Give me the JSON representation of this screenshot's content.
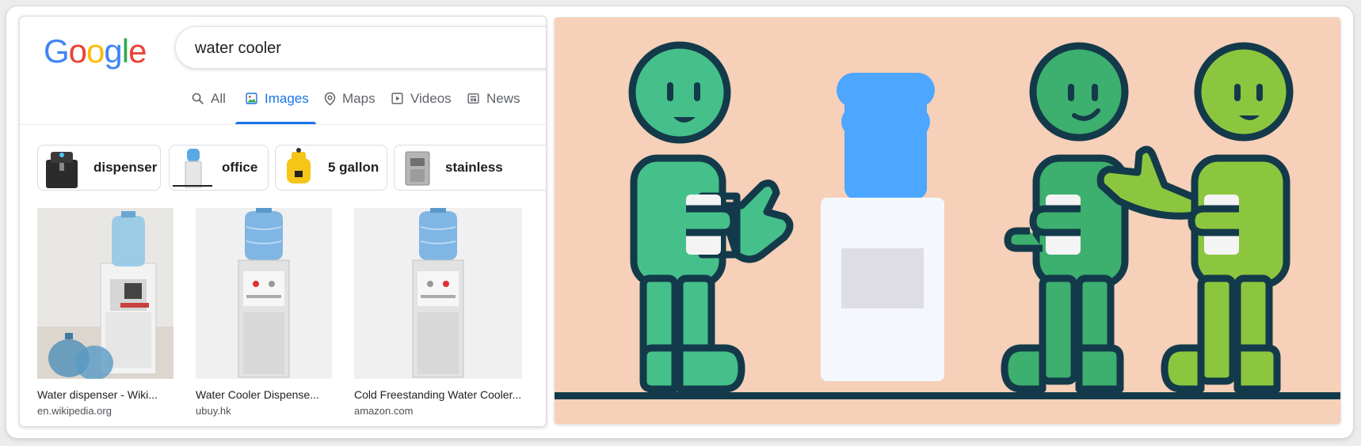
{
  "logo": {
    "letters": [
      "G",
      "o",
      "o",
      "g",
      "l",
      "e"
    ],
    "colors": [
      "#4285F4",
      "#EA4335",
      "#FBBC05",
      "#4285F4",
      "#34A853",
      "#EA4335"
    ]
  },
  "search": {
    "query": "water cooler"
  },
  "tabs": [
    {
      "label": "All",
      "icon": "search-icon"
    },
    {
      "label": "Images",
      "icon": "image-icon",
      "active": true
    },
    {
      "label": "Maps",
      "icon": "map-pin-icon"
    },
    {
      "label": "Videos",
      "icon": "play-icon"
    },
    {
      "label": "News",
      "icon": "news-icon"
    }
  ],
  "chips": [
    {
      "label": "dispenser"
    },
    {
      "label": "office"
    },
    {
      "label": "5 gallon"
    },
    {
      "label": "stainless"
    }
  ],
  "results": [
    {
      "title": "Water dispenser - Wiki...",
      "source": "en.wikipedia.org"
    },
    {
      "title": "Water Cooler Dispense...",
      "source": "ubuy.hk"
    },
    {
      "title": "Cold Freestanding Water Cooler...",
      "source": "amazon.com"
    }
  ],
  "colors": {
    "accent": "#1a73e8",
    "illustration_bg": "#f6d0b8",
    "figure_green_1": "#46c08a",
    "figure_green_2": "#3daf6e",
    "figure_green_3": "#8cc63f",
    "outline": "#133a4a",
    "bottle_blue": "#4da6ff"
  }
}
